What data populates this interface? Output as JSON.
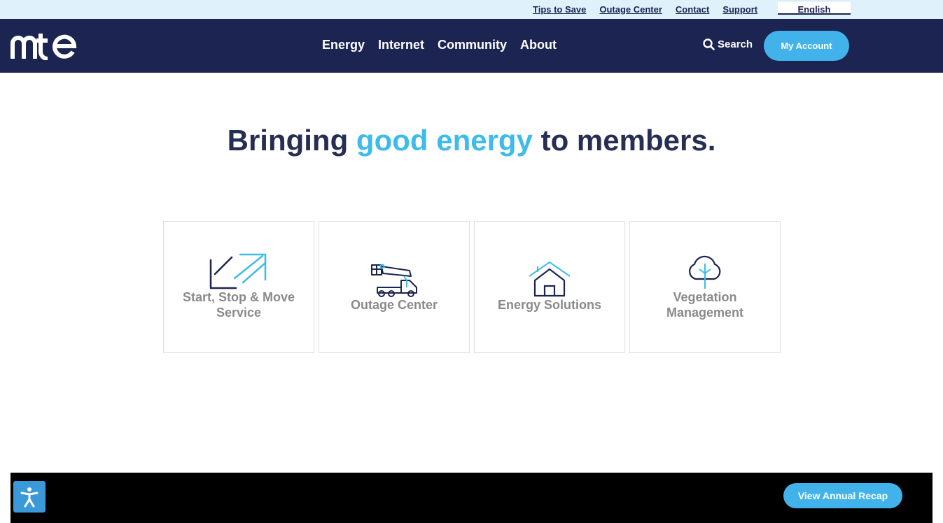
{
  "utility": {
    "links": [
      "Tips to Save",
      "Outage Center",
      "Contact",
      "Support"
    ],
    "language": "English"
  },
  "header": {
    "nav": [
      "Energy",
      "Internet",
      "Community",
      "About"
    ],
    "search_label": "Search",
    "account_label": "My Account"
  },
  "hero": {
    "part1": "Bringing ",
    "accent": "good energy",
    "part2": " to members."
  },
  "tiles": [
    {
      "label": "Start, Stop & Move Service",
      "icon": "arrows-icon"
    },
    {
      "label": "Outage Center",
      "icon": "bucket-truck-icon"
    },
    {
      "label": "Energy Solutions",
      "icon": "house-icon"
    },
    {
      "label": "Vegetation Management",
      "icon": "tree-icon"
    }
  ],
  "footer": {
    "recap_label": "View Annual Recap"
  },
  "colors": {
    "navy": "#1c2451",
    "accent": "#42b3ea",
    "light_blue_bg": "#dff1fb"
  }
}
